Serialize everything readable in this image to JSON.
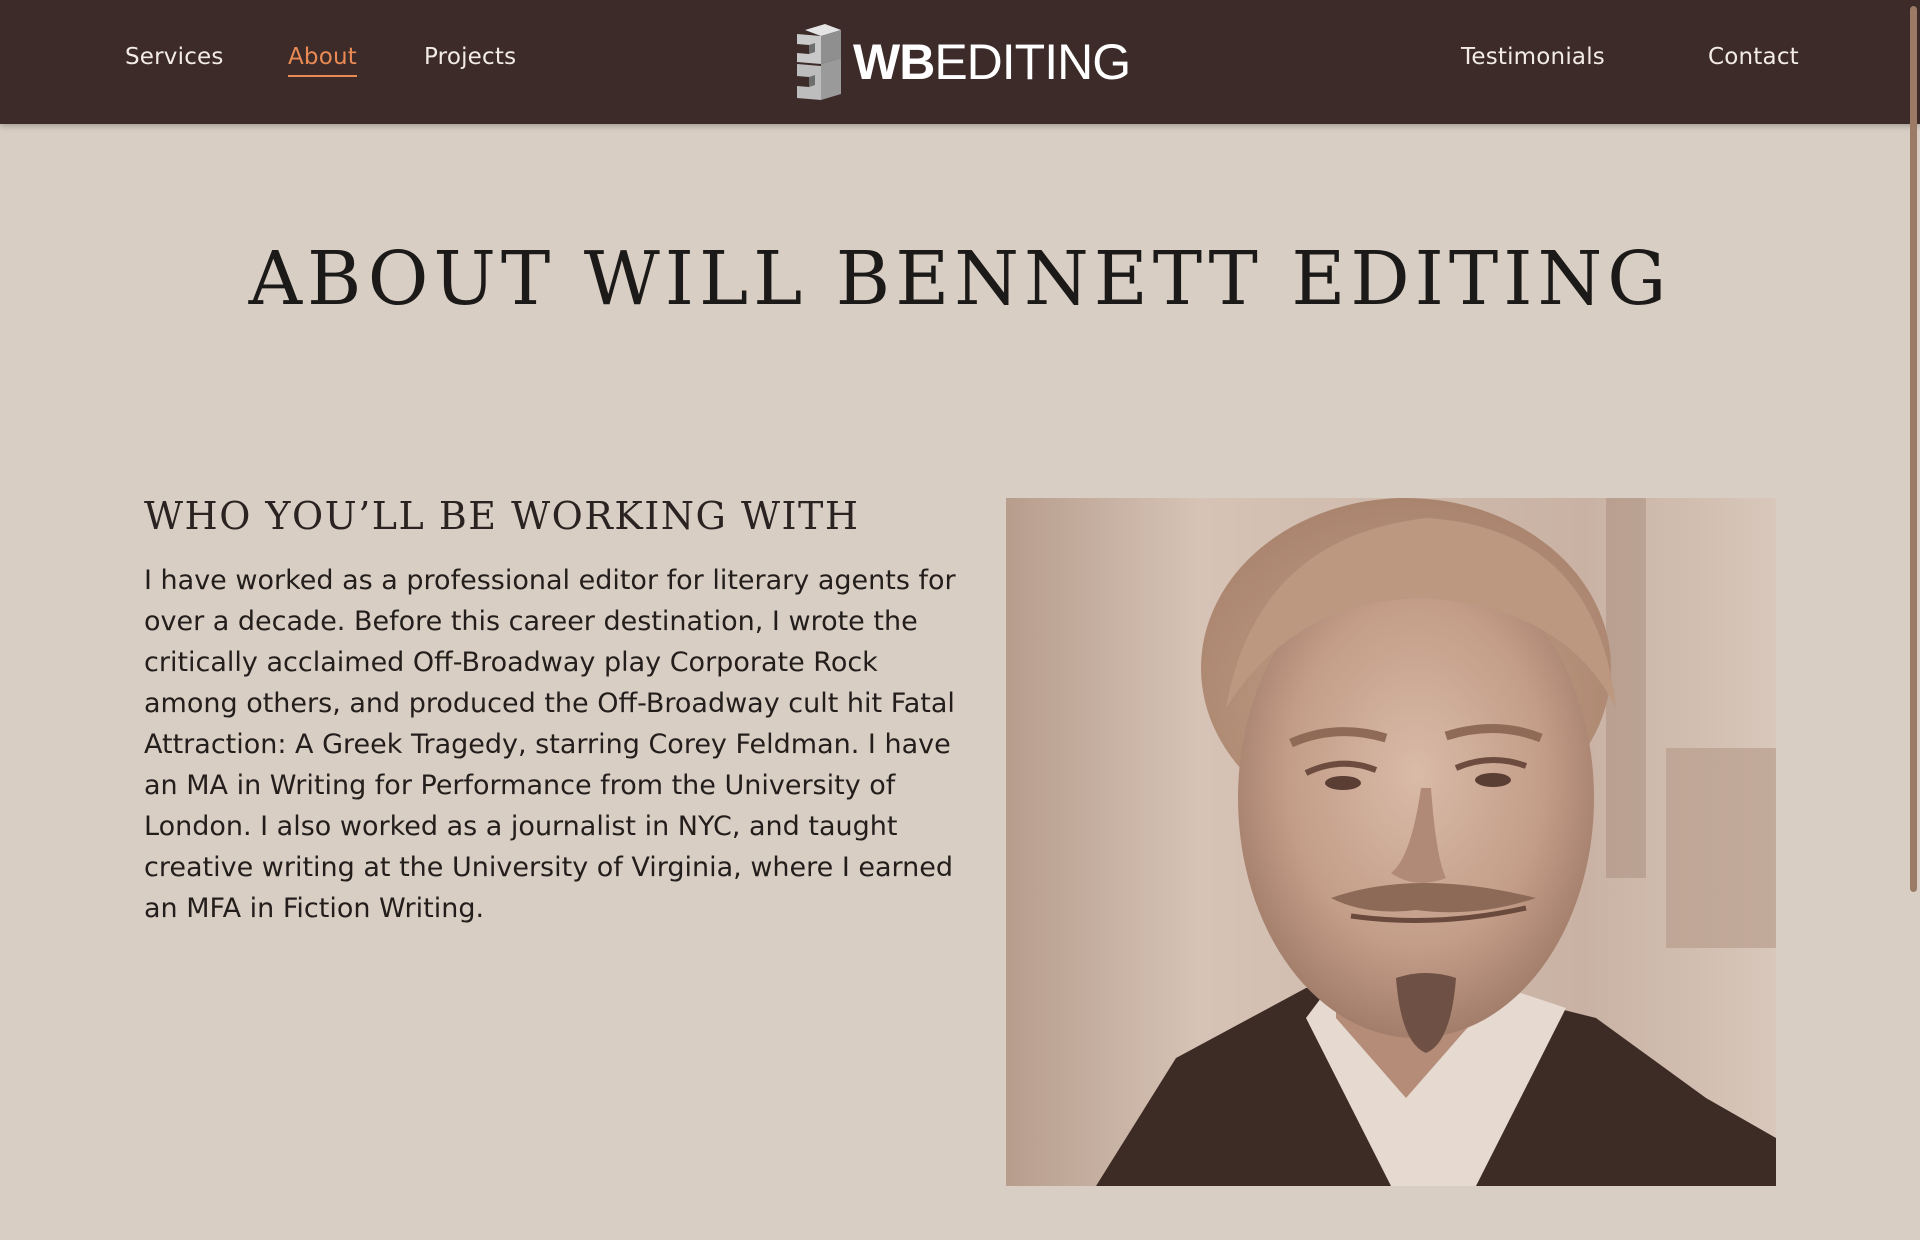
{
  "nav": {
    "left": [
      {
        "label": "Services"
      },
      {
        "label": "About",
        "active": true
      },
      {
        "label": "Projects"
      }
    ],
    "right": [
      {
        "label": "Testimonials"
      },
      {
        "label": "Contact"
      }
    ],
    "logo": {
      "bold": "WB",
      "regular": "EDITING",
      "icon": "stacked-b-logo-icon"
    }
  },
  "colors": {
    "header_bg": "#3c2b28",
    "page_bg": "#d8cec4",
    "accent": "#e98a55",
    "text": "#231d1b"
  },
  "main": {
    "title": "ABOUT WILL BENNETT EDITING",
    "section_heading": "WHO YOU’LL BE WORKING WITH",
    "bio_lines": [
      "I have worked as a professional editor for literary agents for",
      "over a decade. Before this career destination, I wrote the",
      "critically acclaimed Off-Broadway play Corporate Rock",
      "among others, and produced the Off-Broadway cult hit Fatal",
      "Attraction: A Greek Tragedy, starring Corey Feldman. I have",
      "an MA in Writing for Performance from the University of",
      "London. I also worked as a journalist in NYC, and taught",
      "creative writing at the University of Virginia, where I earned",
      "an MFA in Fiction Writing."
    ],
    "photo": {
      "subject": "portrait-photo"
    }
  }
}
